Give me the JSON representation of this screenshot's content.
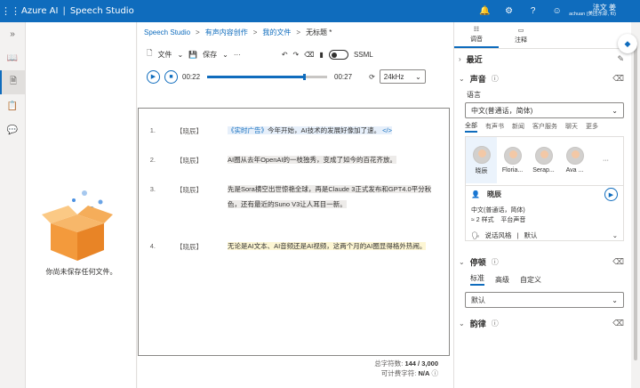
{
  "topbar": {
    "brand": "Azure AI",
    "separator": "|",
    "product": "Speech Studio",
    "user_name": "法文 姜",
    "user_org": "achuan (美团东部, f0)"
  },
  "breadcrumb": {
    "items": [
      "Speech Studio",
      "有声内容创作",
      "我的文件",
      "无标题 *"
    ],
    "sep": ">"
  },
  "toolbar": {
    "file_label": "文件",
    "save_label": "保存",
    "more_label": "···",
    "ssml_label": "SSML"
  },
  "player": {
    "current_time": "00:22",
    "total_time": "00:27",
    "progress": 0.81,
    "sample_rate": "24kHz"
  },
  "file_panel": {
    "empty_message": "你尚未保存任何文件。"
  },
  "editor": {
    "lines": [
      {
        "num": "1.",
        "tag": "【晓辰】",
        "parts": [
          {
            "t": "《实时广告》",
            "cls": "ad"
          },
          {
            "t": "今年开始，AI技术的发展好像加了速。",
            "cls": ""
          },
          {
            "t": " </>",
            "cls": "ad"
          }
        ],
        "hl": "hl-blue"
      },
      {
        "num": "2.",
        "tag": "【晓辰】",
        "parts": [
          {
            "t": "AI圈从去年OpenAI的一枝独秀，变成了如今的百花齐放。",
            "cls": ""
          }
        ],
        "hl": "hl-gray"
      },
      {
        "num": "3.",
        "tag": "【晓辰】",
        "parts": [
          {
            "t": "先是Sora横空出世惊艳全球，再是Claude 3正式发布和GPT4.0平分秋色，还有最近的Suno V3让人耳目一新。",
            "cls": ""
          }
        ],
        "hl": "hl-gray"
      },
      {
        "num": "4.",
        "tag": "【晓辰】",
        "parts": [
          {
            "t": "无论是AI文本、AI音频还是AI视频，这两个月的AI圈显得格外热闹。",
            "cls": ""
          }
        ],
        "hl": "hl-yel"
      }
    ],
    "total_chars_label": "总字符数:",
    "total_chars_value": "144 / 3,000",
    "billable_label": "可计费字符:",
    "billable_value": "N/A"
  },
  "right_panel": {
    "tab_voice": "调音",
    "tab_notes": "注释",
    "recent_label": "最近",
    "voice_section": "声音",
    "language_label": "语言",
    "language_value": "中文(普通话，简体)",
    "filters": [
      "全部",
      "有声书",
      "新闻",
      "客户服务",
      "聊天",
      "更多"
    ],
    "voices": [
      "晓辰",
      "Floria...",
      "Serap...",
      "Ava ..."
    ],
    "voice_name": "晓辰",
    "voice_lang": "中文(普通话，简体)",
    "voice_styles_count": "2 样式",
    "voice_type": "平台声音",
    "speaking_style_label": "说话风格",
    "speaking_style_value": "默认",
    "pause_section": "停顿",
    "pause_tabs": [
      "标准",
      "高级",
      "自定义"
    ],
    "pause_value": "默认",
    "bottom_section": "韵律"
  }
}
